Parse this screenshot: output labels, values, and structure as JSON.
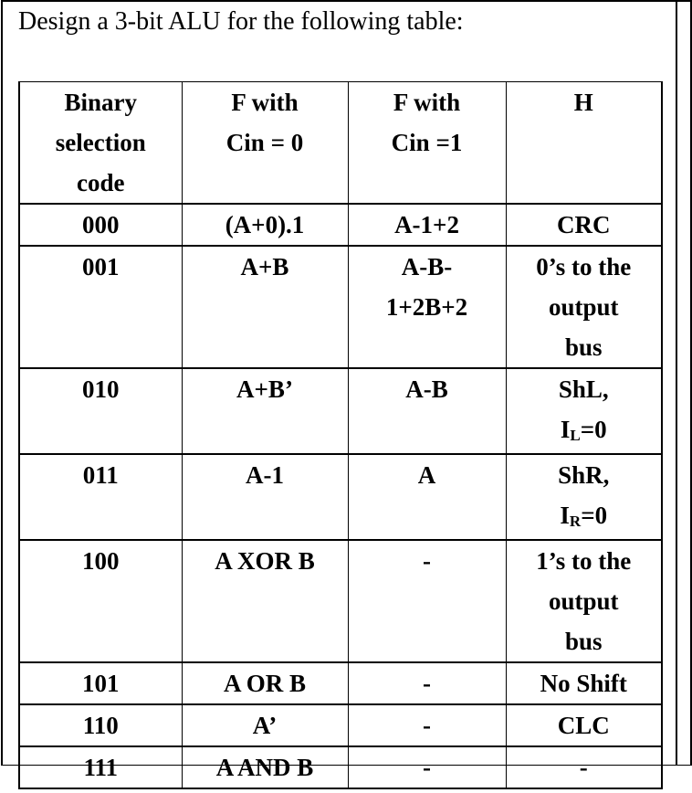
{
  "document": {
    "title": "Design a 3-bit ALU for the following table:"
  },
  "table": {
    "headers": [
      {
        "lines": [
          "Binary",
          "selection",
          "code"
        ]
      },
      {
        "lines": [
          "F with",
          "Cin = 0"
        ]
      },
      {
        "lines": [
          "F with",
          "Cin =1"
        ]
      },
      {
        "lines": [
          "H"
        ]
      }
    ],
    "rows": [
      {
        "code": "000",
        "f_cin0": [
          "(A+0).1"
        ],
        "f_cin1": [
          "A-1+2"
        ],
        "h": [
          {
            "text": "CRC"
          }
        ]
      },
      {
        "code": "001",
        "f_cin0": [
          "A+B"
        ],
        "f_cin1": [
          "A-B-",
          "1+2B+2"
        ],
        "h": [
          {
            "text": "0’s to the"
          },
          {
            "text": "output"
          },
          {
            "text": "bus"
          }
        ]
      },
      {
        "code": "010",
        "f_cin0": [
          "A+B’"
        ],
        "f_cin1": [
          "A-B"
        ],
        "h": [
          {
            "text": "ShL,"
          },
          {
            "main": "I",
            "sub": "L",
            "rest": "=0"
          }
        ]
      },
      {
        "code": "011",
        "f_cin0": [
          "A-1"
        ],
        "f_cin1": [
          "A"
        ],
        "h": [
          {
            "text": "ShR,"
          },
          {
            "main": "I",
            "sub": "R",
            "rest": "=0"
          }
        ]
      },
      {
        "code": "100",
        "f_cin0": [
          "A XOR B"
        ],
        "f_cin1": [
          "-"
        ],
        "h": [
          {
            "text": "1’s to the"
          },
          {
            "text": "output"
          },
          {
            "text": "bus"
          }
        ]
      },
      {
        "code": "101",
        "f_cin0": [
          "A OR B"
        ],
        "f_cin1": [
          "-"
        ],
        "h": [
          {
            "text": "No Shift"
          }
        ]
      },
      {
        "code": "110",
        "f_cin0": [
          "A’"
        ],
        "f_cin1": [
          "-"
        ],
        "h": [
          {
            "text": "CLC"
          }
        ]
      },
      {
        "code": "111",
        "f_cin0": [
          "A AND B"
        ],
        "f_cin1": [
          "-"
        ],
        "h": [
          {
            "text": "-"
          }
        ]
      }
    ]
  }
}
